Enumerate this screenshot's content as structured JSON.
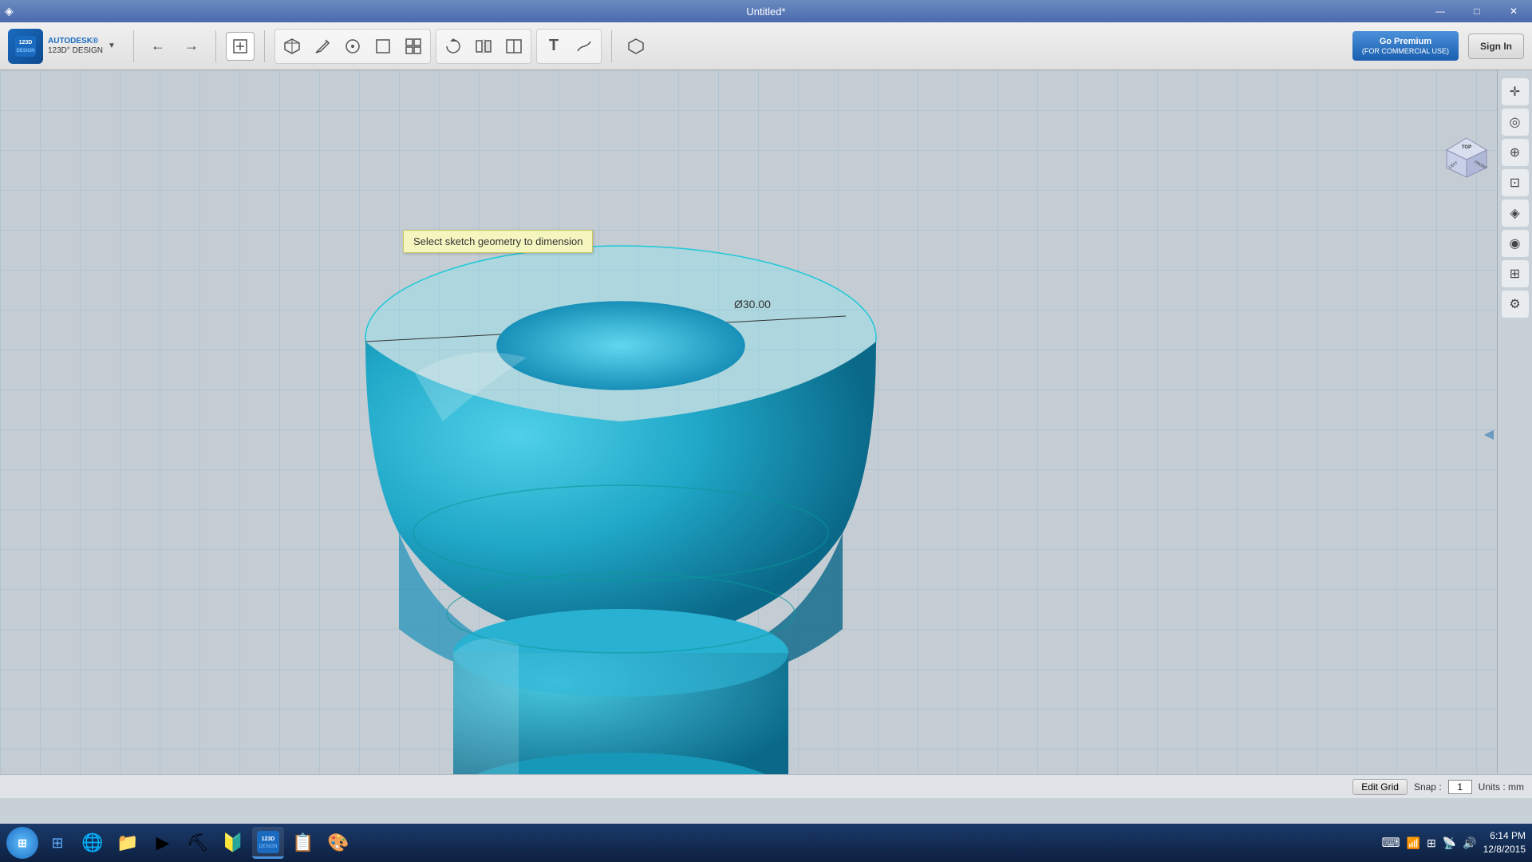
{
  "titlebar": {
    "title": "Untitled*",
    "minimize_label": "—",
    "maximize_label": "□",
    "close_label": "✕"
  },
  "logo": {
    "brand": "AUTODESK®",
    "product": "123D° DESIGN"
  },
  "toolbar": {
    "undo_label": "←",
    "redo_label": "→",
    "new_label": "+",
    "tools": [
      "⬡",
      "✏",
      "◉",
      "⬛",
      "⬚",
      "⟳",
      "◧",
      "▣",
      "T",
      "♜"
    ],
    "extra_label": "⬡"
  },
  "premium": {
    "label": "Go Premium",
    "sub": "(FOR COMMERCIAL USE)"
  },
  "signin": {
    "label": "Sign In"
  },
  "viewport": {
    "tooltip": "Select sketch geometry to dimension",
    "dimension_label": "Ø30.00"
  },
  "right_tools": {
    "items": [
      {
        "name": "pan",
        "icon": "✛"
      },
      {
        "name": "orbit",
        "icon": "◎"
      },
      {
        "name": "zoom",
        "icon": "⊕"
      },
      {
        "name": "fit",
        "icon": "⊡"
      },
      {
        "name": "iso",
        "icon": "◈"
      },
      {
        "name": "view",
        "icon": "◉"
      },
      {
        "name": "layers",
        "icon": "⊞"
      },
      {
        "name": "settings",
        "icon": "⚙"
      }
    ]
  },
  "cube_nav": {
    "top": "TOP",
    "left": "LEFT",
    "front": "FRONT"
  },
  "status_bar": {
    "edit_grid_label": "Edit Grid",
    "snap_label": "Snap : 1",
    "units_label": "Units : mm"
  },
  "taskbar": {
    "start_label": "⊞",
    "apps": [
      "🌀",
      "🌐",
      "📁",
      "▶",
      "⛏",
      "🔰",
      "◆",
      "📋",
      "🎨"
    ],
    "clock_time": "6:14 PM",
    "clock_date": "12/8/2015"
  }
}
